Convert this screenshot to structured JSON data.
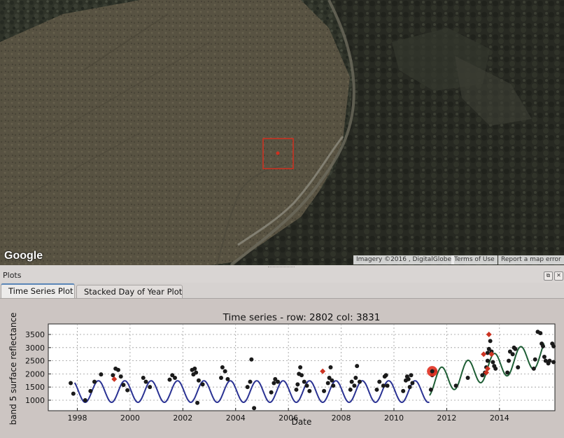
{
  "map": {
    "logo": "Google",
    "attribution": {
      "imagery": "Imagery ©2016 , DigitalGlobe",
      "terms": "Terms of Use",
      "report": "Report a map error"
    },
    "marker_color": "#d03020"
  },
  "dock": {
    "title": "Plots",
    "float_icon": "float-window-icon",
    "close_icon": "close-icon"
  },
  "tabs": [
    {
      "label": "Time Series Plot",
      "active": true
    },
    {
      "label": "Stacked Day of Year Plot",
      "active": false
    }
  ],
  "colors": {
    "fit_early": "#2a3293",
    "fit_late": "#1e5e35",
    "obs": "#1a1a1a",
    "flagged": "#cc3322",
    "break": "#e03020"
  },
  "chart_data": {
    "type": "scatter",
    "title": "Time series - row: 2802 col: 3831",
    "xlabel": "Date",
    "ylabel": "band 5 surface reflectance",
    "xlim": [
      1996.9,
      2016.1
    ],
    "ylim": [
      600,
      3900
    ],
    "x_ticks": [
      1998,
      2000,
      2002,
      2004,
      2006,
      2008,
      2010,
      2012,
      2014
    ],
    "y_ticks": [
      1000,
      1500,
      2000,
      2500,
      3000,
      3500
    ],
    "grid": true,
    "series": [
      {
        "kind": "fit",
        "segment": "early",
        "x_range": [
          1997.9,
          2011.35
        ],
        "mean": 1330,
        "amplitude": 410,
        "phase": 1998.55
      },
      {
        "kind": "fit",
        "segment": "late",
        "x_range": [
          2011.35,
          2015.7
        ],
        "mean": 1650,
        "amplitude": 490,
        "phase": 2011.55,
        "trend": 260
      },
      {
        "kind": "obs",
        "points": [
          [
            1997.75,
            1650
          ],
          [
            1997.85,
            1250
          ],
          [
            1998.3,
            1000
          ],
          [
            1998.5,
            1350
          ],
          [
            1998.65,
            1700
          ],
          [
            1998.9,
            1980
          ],
          [
            1999.35,
            1950
          ],
          [
            1999.45,
            2200
          ],
          [
            1999.55,
            2150
          ],
          [
            1999.65,
            1900
          ],
          [
            1999.75,
            1580
          ],
          [
            1999.9,
            1380
          ],
          [
            2000.5,
            1850
          ],
          [
            2000.6,
            1700
          ],
          [
            2000.75,
            1500
          ],
          [
            2001.5,
            1780
          ],
          [
            2001.6,
            1950
          ],
          [
            2001.7,
            1850
          ],
          [
            2002.35,
            2150
          ],
          [
            2002.4,
            1980
          ],
          [
            2002.45,
            2200
          ],
          [
            2002.5,
            2050
          ],
          [
            2002.55,
            900
          ],
          [
            2002.6,
            1750
          ],
          [
            2002.75,
            1600
          ],
          [
            2003.45,
            1850
          ],
          [
            2003.5,
            2250
          ],
          [
            2003.6,
            2100
          ],
          [
            2003.7,
            1800
          ],
          [
            2004.45,
            1500
          ],
          [
            2004.55,
            1700
          ],
          [
            2004.6,
            2550
          ],
          [
            2004.7,
            700
          ],
          [
            2005.35,
            1300
          ],
          [
            2005.45,
            1650
          ],
          [
            2005.5,
            1800
          ],
          [
            2005.6,
            1700
          ],
          [
            2006.3,
            1400
          ],
          [
            2006.35,
            1600
          ],
          [
            2006.4,
            2000
          ],
          [
            2006.45,
            2250
          ],
          [
            2006.5,
            1950
          ],
          [
            2006.6,
            1700
          ],
          [
            2006.7,
            1550
          ],
          [
            2006.8,
            1350
          ],
          [
            2007.35,
            1350
          ],
          [
            2007.5,
            1650
          ],
          [
            2007.55,
            1850
          ],
          [
            2007.6,
            2250
          ],
          [
            2007.65,
            1750
          ],
          [
            2007.7,
            1550
          ],
          [
            2008.35,
            1400
          ],
          [
            2008.4,
            1700
          ],
          [
            2008.5,
            1550
          ],
          [
            2008.55,
            1850
          ],
          [
            2008.6,
            2300
          ],
          [
            2008.7,
            1700
          ],
          [
            2009.35,
            1400
          ],
          [
            2009.45,
            1700
          ],
          [
            2009.6,
            1550
          ],
          [
            2009.65,
            1900
          ],
          [
            2009.7,
            1950
          ],
          [
            2009.75,
            1550
          ],
          [
            2010.35,
            1350
          ],
          [
            2010.45,
            1750
          ],
          [
            2010.5,
            1900
          ],
          [
            2010.55,
            1800
          ],
          [
            2010.6,
            1500
          ],
          [
            2010.65,
            1950
          ],
          [
            2010.7,
            1650
          ],
          [
            2011.4,
            1400
          ],
          [
            2011.45,
            1950
          ],
          [
            2011.55,
            2100
          ],
          [
            2012.35,
            1550
          ],
          [
            2012.8,
            1850
          ],
          [
            2013.35,
            1950
          ],
          [
            2013.45,
            2050
          ],
          [
            2013.5,
            2250
          ],
          [
            2013.55,
            2500
          ],
          [
            2013.55,
            2800
          ],
          [
            2013.6,
            2950
          ],
          [
            2013.65,
            3250
          ],
          [
            2013.7,
            2850
          ],
          [
            2013.75,
            2450
          ],
          [
            2013.8,
            2300
          ],
          [
            2013.85,
            2200
          ],
          [
            2014.3,
            2050
          ],
          [
            2014.35,
            2500
          ],
          [
            2014.4,
            2850
          ],
          [
            2014.5,
            2750
          ],
          [
            2014.55,
            3000
          ],
          [
            2014.6,
            2950
          ],
          [
            2014.7,
            2250
          ],
          [
            2015.3,
            2200
          ],
          [
            2015.35,
            2550
          ],
          [
            2015.45,
            3600
          ],
          [
            2015.55,
            3550
          ],
          [
            2015.6,
            3150
          ],
          [
            2015.65,
            3050
          ],
          [
            2015.7,
            2650
          ],
          [
            2015.75,
            2500
          ],
          [
            2015.85,
            2400
          ],
          [
            2015.9,
            2500
          ],
          [
            2016.0,
            3150
          ],
          [
            2016.05,
            3050
          ],
          [
            2016.05,
            2450
          ]
        ]
      },
      {
        "kind": "flagged",
        "points": [
          [
            1999.4,
            1800
          ],
          [
            2007.3,
            2100
          ],
          [
            2011.5,
            2050
          ],
          [
            2013.4,
            2750
          ],
          [
            2013.5,
            2050
          ],
          [
            2013.55,
            2200
          ],
          [
            2013.6,
            3500
          ],
          [
            2013.7,
            2750
          ]
        ]
      },
      {
        "kind": "break",
        "points": [
          [
            2011.45,
            2100
          ]
        ]
      }
    ]
  }
}
